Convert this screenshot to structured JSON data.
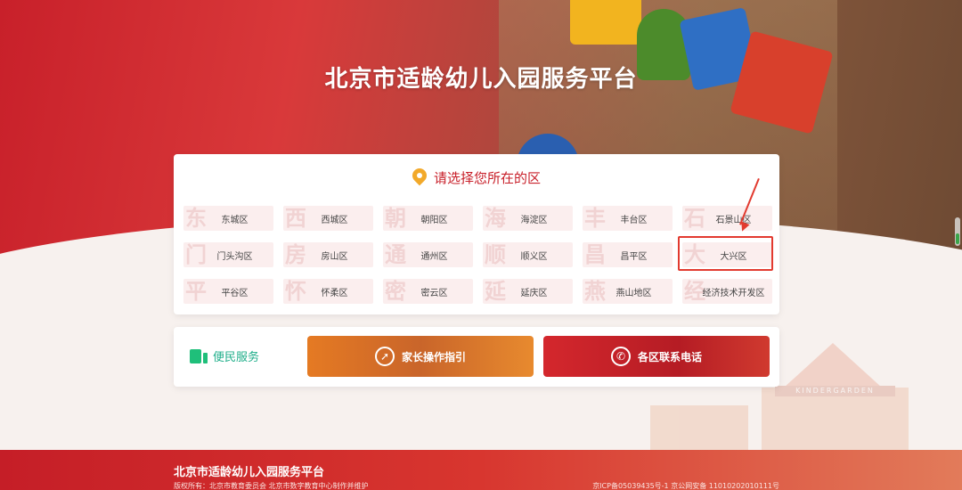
{
  "header": {
    "title": "北京市适龄幼儿入园服务平台"
  },
  "district_card": {
    "title": "请选择您所在的区",
    "districts": [
      {
        "glyph": "东",
        "name": "东城区"
      },
      {
        "glyph": "西",
        "name": "西城区"
      },
      {
        "glyph": "朝",
        "name": "朝阳区"
      },
      {
        "glyph": "海",
        "name": "海淀区"
      },
      {
        "glyph": "丰",
        "name": "丰台区"
      },
      {
        "glyph": "石",
        "name": "石景山区"
      },
      {
        "glyph": "门",
        "name": "门头沟区"
      },
      {
        "glyph": "房",
        "name": "房山区"
      },
      {
        "glyph": "通",
        "name": "通州区"
      },
      {
        "glyph": "顺",
        "name": "顺义区"
      },
      {
        "glyph": "昌",
        "name": "昌平区"
      },
      {
        "glyph": "大",
        "name": "大兴区"
      },
      {
        "glyph": "平",
        "name": "平谷区"
      },
      {
        "glyph": "怀",
        "name": "怀柔区"
      },
      {
        "glyph": "密",
        "name": "密云区"
      },
      {
        "glyph": "延",
        "name": "延庆区"
      },
      {
        "glyph": "燕",
        "name": "燕山地区"
      },
      {
        "glyph": "经",
        "name": "经济技术开发区"
      }
    ],
    "highlighted": "大兴区"
  },
  "services": {
    "label": "便民服务",
    "guide_button": "家长操作指引",
    "phone_button": "各区联系电话"
  },
  "illustration": {
    "sign": "KINDERGARDEN"
  },
  "footer": {
    "title": "北京市适龄幼儿入园服务平台",
    "copyright": "版权所有：北京市教育委员会 北京市数字教育中心制作并维护",
    "icp": "京ICP备05039435号-1 京公网安备 11010202010111号"
  },
  "colors": {
    "brand_red": "#c8202a",
    "accent_orange": "#e57a23",
    "service_green": "#1fbf7a",
    "highlight": "#e23a2f"
  }
}
